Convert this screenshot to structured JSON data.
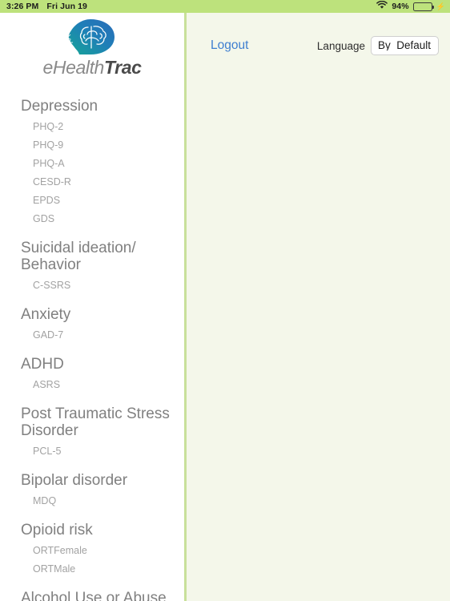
{
  "status_bar": {
    "time": "3:26 PM",
    "date": "Fri Jun 19",
    "wifi_icon": "wifi-icon",
    "battery_percent": "94%",
    "battery_level": 94,
    "charging_icon": "lightning-bolt-icon",
    "background_color": "#bde27c"
  },
  "branding": {
    "logo_icon": "head-with-brain-logo",
    "wordmark_light": "eHealth",
    "wordmark_bold": "Trac",
    "logo_color_start": "#2b6cb8",
    "logo_color_end": "#16a596"
  },
  "topbar": {
    "logout_label": "Logout",
    "logout_color": "#3f7fd0",
    "language_label": "Language",
    "language_value": "By_Default",
    "language_options": [
      "By_Default"
    ]
  },
  "theme": {
    "sidebar_background": "#ffffff",
    "content_background": "#f4f7ea",
    "divider_color": "#c8e09a",
    "category_text": "#808080",
    "item_text": "#a2a2a2"
  },
  "sidebar": {
    "categories": [
      {
        "label": "Depression",
        "items": [
          "PHQ-2",
          "PHQ-9",
          "PHQ-A",
          "CESD-R",
          "EPDS",
          "GDS"
        ]
      },
      {
        "label": "Suicidal ideation/ Behavior",
        "items": [
          "C-SSRS"
        ]
      },
      {
        "label": "Anxiety",
        "items": [
          "GAD-7"
        ]
      },
      {
        "label": "ADHD",
        "items": [
          "ASRS"
        ]
      },
      {
        "label": "Post Traumatic Stress Disorder",
        "items": [
          "PCL-5"
        ]
      },
      {
        "label": "Bipolar disorder",
        "items": [
          "MDQ"
        ]
      },
      {
        "label": "Opioid risk",
        "items": [
          "ORTFemale",
          "ORTMale"
        ]
      },
      {
        "label": "Alcohol Use or Abuse",
        "items": []
      }
    ]
  }
}
